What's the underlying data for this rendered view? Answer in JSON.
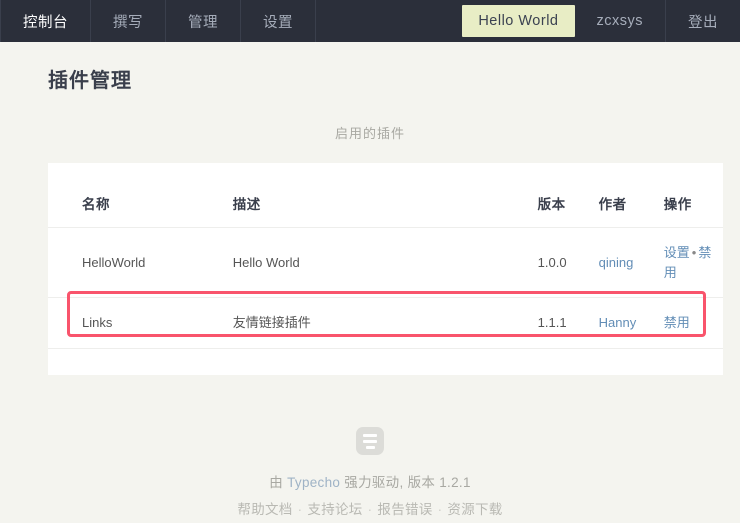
{
  "navbar": {
    "background": "#2b2f3a",
    "left_items": [
      {
        "label": "控制台",
        "active": true
      },
      {
        "label": "撰写",
        "active": false
      },
      {
        "label": "管理",
        "active": false
      },
      {
        "label": "设置",
        "active": false
      }
    ],
    "right_items": [
      {
        "label": "Hello World",
        "badge": true,
        "badge_color": "#e8edc5"
      },
      {
        "label": "zcxsys",
        "badge": false
      },
      {
        "label": "登出",
        "badge": false
      }
    ]
  },
  "main": {
    "page_title": "插件管理",
    "section_heading": "启用的插件",
    "table": {
      "headers": [
        "名称",
        "描述",
        "版本",
        "作者",
        "操作"
      ],
      "rows": [
        {
          "name": "HelloWorld",
          "description": "Hello World",
          "version": "1.0.0",
          "author": "qining",
          "actions": [
            {
              "label": "设置"
            },
            {
              "label": "禁用"
            }
          ],
          "action_separator": "•",
          "highlighted": false
        },
        {
          "name": "Links",
          "description": "友情链接插件",
          "version": "1.1.1",
          "author": "Hanny",
          "actions": [
            {
              "label": "禁用"
            }
          ],
          "action_separator": "•",
          "highlighted": true
        }
      ]
    },
    "highlight_color": "#f9546c"
  },
  "footer": {
    "logo_icon": "typecho-logo-icon",
    "powered_prefix": "由 ",
    "powered_link": "Typecho",
    "powered_suffix": " 强力驱动, 版本 1.2.1",
    "links": [
      {
        "label": "帮助文档"
      },
      {
        "label": "支持论坛"
      },
      {
        "label": "报告错误"
      },
      {
        "label": "资源下载"
      }
    ],
    "link_separator": "·"
  }
}
